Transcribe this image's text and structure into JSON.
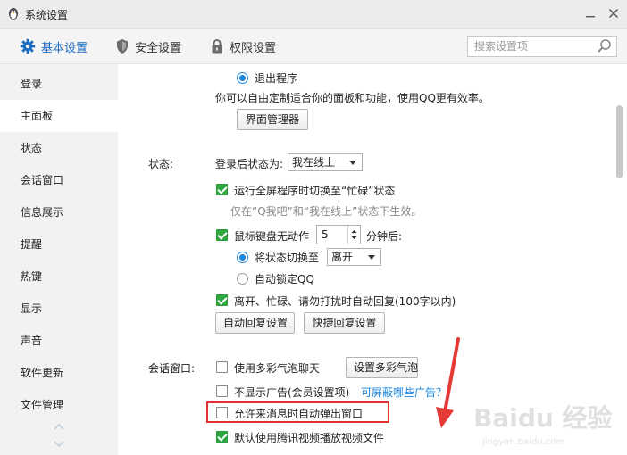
{
  "window": {
    "title": "系统设置",
    "app_icon": "penguin-icon",
    "controls": [
      "minimize-icon",
      "close-icon"
    ]
  },
  "topnav": {
    "tabs": [
      {
        "label": "基本设置",
        "icon": "gear-icon",
        "active": true
      },
      {
        "label": "安全设置",
        "icon": "shield-icon",
        "active": false
      },
      {
        "label": "权限设置",
        "icon": "lock-icon",
        "active": false
      }
    ],
    "search_placeholder": "搜索设置项"
  },
  "sidebar": {
    "items": [
      {
        "label": "登录"
      },
      {
        "label": "主面板",
        "active": true
      },
      {
        "label": "状态"
      },
      {
        "label": "会话窗口"
      },
      {
        "label": "信息展示"
      },
      {
        "label": "提醒"
      },
      {
        "label": "热键"
      },
      {
        "label": "显示"
      },
      {
        "label": "声音"
      },
      {
        "label": "软件更新"
      },
      {
        "label": "文件管理"
      }
    ]
  },
  "main_panel": {
    "exit_option": "退出程序",
    "customize_text": "你可以自由定制适合你的面板和功能，使用QQ更有效率。",
    "manager_button": "界面管理器"
  },
  "status": {
    "section_label": "状态:",
    "after_login_label": "登录后状态为:",
    "after_login_value": "我在线上",
    "fullscreen_busy": "运行全屏程序时切换至“忙碌”状态",
    "fullscreen_note": "仅在“Q我吧”和“我在线上”状态下生效。",
    "idle_prefix": "鼠标键盘无动作",
    "idle_minutes": "5",
    "idle_suffix": "分钟后:",
    "switch_to_label": "将状态切换至",
    "switch_to_value": "离开",
    "auto_lock": "自动锁定QQ",
    "auto_reply": "离开、忙碌、请勿打扰时自动回复(100字以内)",
    "auto_reply_button": "自动回复设置",
    "quick_reply_button": "快捷回复设置"
  },
  "session": {
    "section_label": "会话窗口:",
    "bubble_chat": "使用多彩气泡聊天",
    "bubble_button": "设置多彩气泡",
    "hide_ads": "不显示广告(会员设置项)",
    "ads_link": "可屏蔽哪些广告？",
    "popup_on_message": "允许来消息时自动弹出窗口",
    "tencent_video": "默认使用腾讯视频播放视频文件"
  },
  "annotation": {
    "watermark_text": "Baidu 经验",
    "watermark_sub": "jingyan.baidu.com",
    "arrow_color": "#e53935",
    "box_color": "#e03030"
  },
  "colors": {
    "accent": "#1a6cc1",
    "check_green": "#30a842",
    "radio_blue": "#1a86e0"
  }
}
